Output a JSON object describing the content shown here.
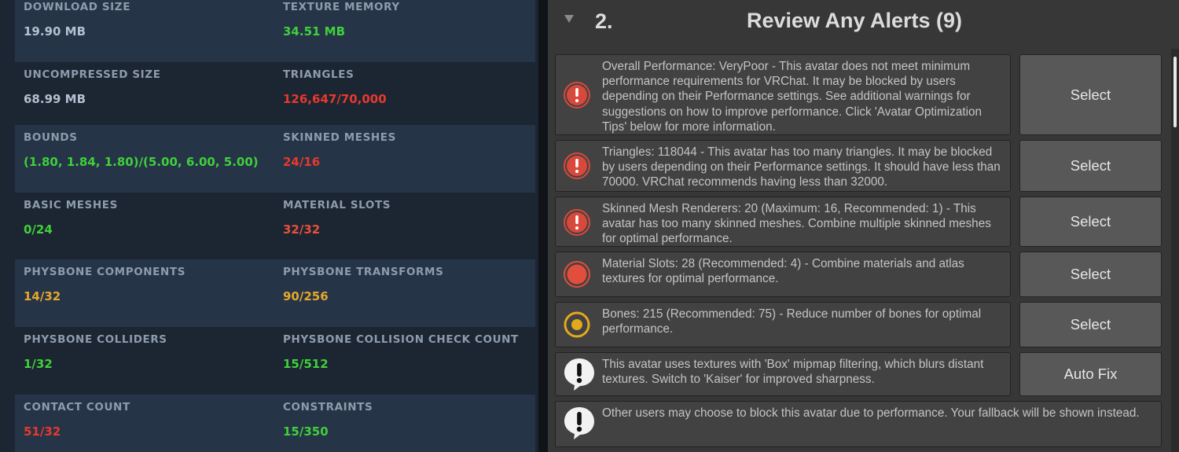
{
  "stats": [
    {
      "label": "DOWNLOAD SIZE",
      "value": "19.90 MB",
      "color": "#b3c0cf"
    },
    {
      "label": "TEXTURE MEMORY",
      "value": "34.51 MB",
      "color": "#3fd03a"
    },
    {
      "label": "UNCOMPRESSED SIZE",
      "value": "68.99 MB",
      "color": "#b3c0cf"
    },
    {
      "label": "TRIANGLES",
      "value": "126,647/70,000",
      "color": "#e8392c"
    },
    {
      "label": "BOUNDS",
      "value": "(1.80, 1.84, 1.80)/(5.00, 6.00, 5.00)",
      "color": "#3fd03a"
    },
    {
      "label": "SKINNED MESHES",
      "value": "24/16",
      "color": "#e8392c"
    },
    {
      "label": "BASIC MESHES",
      "value": "0/24",
      "color": "#3fd03a"
    },
    {
      "label": "MATERIAL SLOTS",
      "value": "32/32",
      "color": "#e8503a"
    },
    {
      "label": "PHYSBONE COMPONENTS",
      "value": "14/32",
      "color": "#e6a82a"
    },
    {
      "label": "PHYSBONE TRANSFORMS",
      "value": "90/256",
      "color": "#e6a82a"
    },
    {
      "label": "PHYSBONE COLLIDERS",
      "value": "1/32",
      "color": "#3fd03a"
    },
    {
      "label": "PHYSBONE COLLISION CHECK COUNT",
      "value": "15/512",
      "color": "#3fd03a"
    },
    {
      "label": "CONTACT COUNT",
      "value": "51/32",
      "color": "#e8392c"
    },
    {
      "label": "CONSTRAINTS",
      "value": "15/350",
      "color": "#3fd03a"
    }
  ],
  "review": {
    "number": "2.",
    "title": "Review Any Alerts (9)",
    "alerts": [
      {
        "icon": "error-icon",
        "text": "Overall Performance: VeryPoor - This avatar does not meet minimum performance requirements for VRChat. It may be blocked by users depending on their Performance settings. See additional warnings for suggestions on how to improve performance. Click 'Avatar Optimization Tips' below for more information.",
        "button": "Select"
      },
      {
        "icon": "error-icon",
        "text": "Triangles: 118044 - This avatar has too many triangles. It may be blocked by users depending on their Performance settings. It should have less than 70000. VRChat recommends having less than 32000.",
        "button": "Select"
      },
      {
        "icon": "error-icon",
        "text": "Skinned Mesh Renderers: 20 (Maximum: 16, Recommended: 1) - This avatar has too many skinned meshes. Combine multiple skinned meshes for optimal performance.",
        "button": "Select"
      },
      {
        "icon": "poor-performance-icon",
        "text": "Material Slots: 28 (Recommended: 4) - Combine materials and atlas textures for optimal performance.",
        "button": "Select"
      },
      {
        "icon": "medium-performance-icon",
        "text": "Bones: 215 (Recommended: 75) - Reduce number of bones for optimal performance.",
        "button": "Select"
      },
      {
        "icon": "info-bubble-icon",
        "text": "This avatar uses textures with 'Box' mipmap filtering, which blurs distant textures. Switch to 'Kaiser' for improved sharpness.",
        "button": "Auto Fix"
      },
      {
        "icon": "info-bubble-icon",
        "text": "Other users may choose to block this avatar due to performance. Your fallback will be shown instead.",
        "button": ""
      }
    ]
  }
}
